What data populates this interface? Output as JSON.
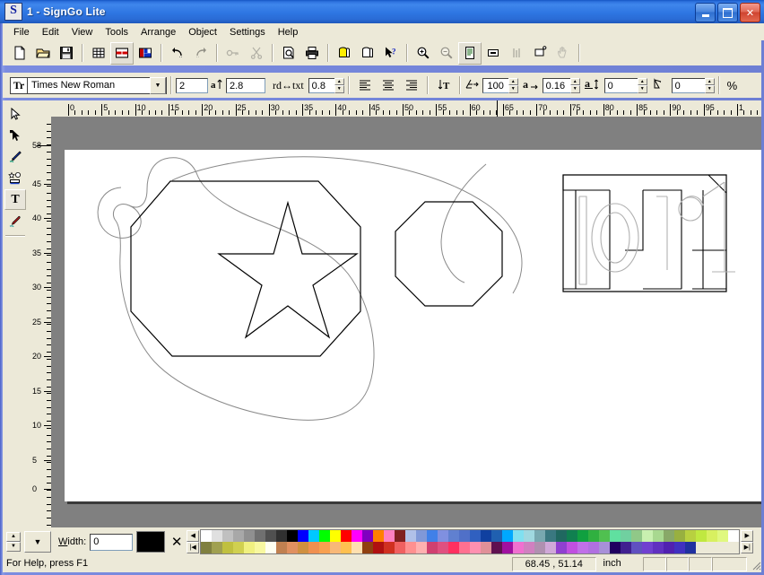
{
  "window": {
    "title": "1 - SignGo Lite",
    "icon": "signgo-logo-icon",
    "minimize_label": "Minimize",
    "maximize_label": "Maximize",
    "close_label": "Close"
  },
  "menu": {
    "items": [
      {
        "label": "File"
      },
      {
        "label": "Edit"
      },
      {
        "label": "View"
      },
      {
        "label": "Tools"
      },
      {
        "label": "Arrange"
      },
      {
        "label": "Object"
      },
      {
        "label": "Settings"
      },
      {
        "label": "Help"
      }
    ]
  },
  "toolbar_main": {
    "buttons": [
      {
        "name": "new-icon",
        "tip": "New"
      },
      {
        "name": "open-icon",
        "tip": "Open"
      },
      {
        "name": "save-icon",
        "tip": "Save"
      },
      {
        "name": "grid-icon",
        "tip": "Show Grid"
      },
      {
        "name": "layout-red-icon",
        "tip": "Layout"
      },
      {
        "name": "panels-icon",
        "tip": "Panels"
      },
      {
        "name": "undo-icon",
        "tip": "Undo"
      },
      {
        "name": "redo-icon",
        "tip": "Redo"
      },
      {
        "name": "key-icon",
        "tip": "Key"
      },
      {
        "name": "cut-icon",
        "tip": "Cut"
      },
      {
        "name": "print-preview-icon",
        "tip": "Print Preview"
      },
      {
        "name": "print-icon",
        "tip": "Print"
      },
      {
        "name": "plot-yellow-icon",
        "tip": "Plot"
      },
      {
        "name": "plot-icon",
        "tip": "Plot Manager"
      },
      {
        "name": "help-pointer-icon",
        "tip": "Context Help"
      },
      {
        "name": "zoom-in-icon",
        "tip": "Zoom In"
      },
      {
        "name": "zoom-out-icon",
        "tip": "Zoom Out"
      },
      {
        "name": "page-view-icon",
        "tip": "Fit Page"
      },
      {
        "name": "zoom-selection-icon",
        "tip": "Zoom Selection"
      },
      {
        "name": "measure-icon",
        "tip": "Measure"
      },
      {
        "name": "node-edit-icon",
        "tip": "Node Edit"
      },
      {
        "name": "pan-hand-icon",
        "tip": "Pan"
      }
    ]
  },
  "toolbar_text": {
    "font_icon": "font-face-icon",
    "font_name": "Times New Roman",
    "font_size": "2",
    "line_height_icon": "line-height-icon",
    "line_height": "2.8",
    "word_space_label": "rd↔txt",
    "word_space": "0.8",
    "align_left_icon": "align-left-icon",
    "align_center_icon": "align-center-icon",
    "align_right_icon": "align-right-icon",
    "vertical_text_icon": "vertical-text-icon",
    "scale_icon": "horizontal-scale-icon",
    "scale_value": "100",
    "char_space_icon": "character-spacing-icon",
    "char_space_value": "0.16",
    "baseline_icon": "baseline-shift-icon",
    "baseline_value": "0",
    "slant_icon": "slant-angle-icon",
    "slant_value": "0",
    "percent_label": "%"
  },
  "toolbox": {
    "tools": [
      {
        "name": "select-arrow-tool",
        "label": "Select"
      },
      {
        "name": "node-edit-tool",
        "label": "Node Edit"
      },
      {
        "name": "pen-draw-tool",
        "label": "Draw"
      },
      {
        "name": "shapes-tool",
        "label": "Shapes"
      },
      {
        "name": "text-tool",
        "label": "Text",
        "selected": true
      },
      {
        "name": "eyedropper-tool",
        "label": "Eyedropper"
      }
    ]
  },
  "rulers": {
    "unit": "inch",
    "horizontal_ticks": [
      "0",
      "5",
      "10",
      "15",
      "20",
      "25",
      "30",
      "35",
      "40",
      "45",
      "50",
      "55",
      "60",
      "65",
      "70",
      "75",
      "80",
      "85",
      "90",
      "95",
      "1"
    ],
    "vertical_ticks": [
      "58",
      "45",
      "40",
      "35",
      "30",
      "25",
      "20",
      "15",
      "10",
      "5",
      "0"
    ]
  },
  "canvas": {
    "objects": [
      {
        "name": "freeform-curve",
        "color": "#8a8a8a"
      },
      {
        "name": "octagon-large",
        "color": "#000000"
      },
      {
        "name": "star-shape",
        "color": "#000000"
      },
      {
        "name": "octagon-small",
        "color": "#000000"
      },
      {
        "name": "text-outline-pr1",
        "text": "pr1",
        "color": "#000000"
      }
    ]
  },
  "bottombar": {
    "width_label": "Width:",
    "width_value": "0",
    "fill_color": "#000000",
    "no_fill_icon": "no-fill-icon",
    "spin_up_icon": "spin-up-icon",
    "spin_down_icon": "spin-down-icon",
    "dropdown_icon": "chevron-down-icon",
    "palette_prev_icon": "palette-prev-icon",
    "palette_first_icon": "palette-first-icon",
    "palette_next_icon": "palette-next-icon",
    "palette_last_icon": "palette-last-icon",
    "palette_row1": [
      "#ffffff",
      "#e0e0e0",
      "#c0c0c0",
      "#a8a8a8",
      "#909090",
      "#707070",
      "#505050",
      "#303030",
      "#000000",
      "#0000ff",
      "#00c8ff",
      "#00ff00",
      "#ffff00",
      "#ff0000",
      "#ff00ff",
      "#8000c0",
      "#ff8000",
      "#ff80c0",
      "#802020",
      "#b0c0e8",
      "#8098d8",
      "#4080e8",
      "#8090e0",
      "#6080d0",
      "#5070c8",
      "#3060c0",
      "#1040a0",
      "#2060b0",
      "#00a8ff",
      "#80e0f0",
      "#a0d8e0",
      "#78a8b0",
      "#3a7880",
      "#206860",
      "#108050",
      "#10a040",
      "#30b040",
      "#50c050",
      "#60e0a0",
      "#70d0a0",
      "#90c888",
      "#c8f0b0",
      "#a8d890",
      "#88a868",
      "#98b040",
      "#b8d040",
      "#c0e840",
      "#d8f060",
      "#e0f880"
    ],
    "palette_row2": [
      "#808040",
      "#a0a050",
      "#c0c040",
      "#d0d050",
      "#f0f080",
      "#f8f8a0",
      "#fffff0",
      "#c08050",
      "#e09060",
      "#d09040",
      "#f09050",
      "#f8a050",
      "#f8b878",
      "#ffc050",
      "#ffe0b0",
      "#904010",
      "#b01010",
      "#d03020",
      "#f06060",
      "#ff9090",
      "#ffb0b0",
      "#d04070",
      "#e05080",
      "#ff3060",
      "#ff7090",
      "#ff90b0",
      "#e09098",
      "#601050",
      "#a010a0",
      "#f070d0",
      "#d080c0",
      "#b090b0",
      "#d0a8d8",
      "#9040d0",
      "#c050e0",
      "#c070e8",
      "#b070e0",
      "#a890d8",
      "#200060",
      "#402090",
      "#6050c0",
      "#7040d0",
      "#6030c0",
      "#5020b0",
      "#4030c0",
      "#2030a0",
      "#ece9d8",
      "#ece9d8",
      "#ece9d8",
      "#ece9d8"
    ]
  },
  "statusbar": {
    "help_text": "For Help, press F1",
    "coordinates": "68.45 , 51.14",
    "unit": "inch"
  }
}
